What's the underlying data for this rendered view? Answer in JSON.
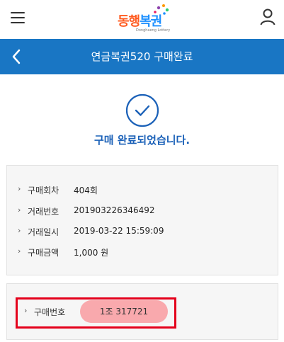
{
  "topbar": {
    "logo_text_a": "동행",
    "logo_text_b": "복권",
    "logo_sub": "Donghaeng Lottery"
  },
  "header": {
    "title": "연금복권520 구매완료"
  },
  "success": {
    "message": "구매 완료되었습니다."
  },
  "details": [
    {
      "label": "구매회차",
      "value": "404회"
    },
    {
      "label": "거래번호",
      "value": "201903226346492"
    },
    {
      "label": "거래일시",
      "value": "2019-03-22 15:59:09"
    },
    {
      "label": "구매금액",
      "value": "1,000 원"
    }
  ],
  "ticket": {
    "label": "구매번호",
    "number": "1조 317721"
  },
  "colors": {
    "header_bg": "#1976c4",
    "success_text": "#1b61b8",
    "highlight_border": "#e4001b",
    "pill_bg": "#f9a9ad"
  }
}
